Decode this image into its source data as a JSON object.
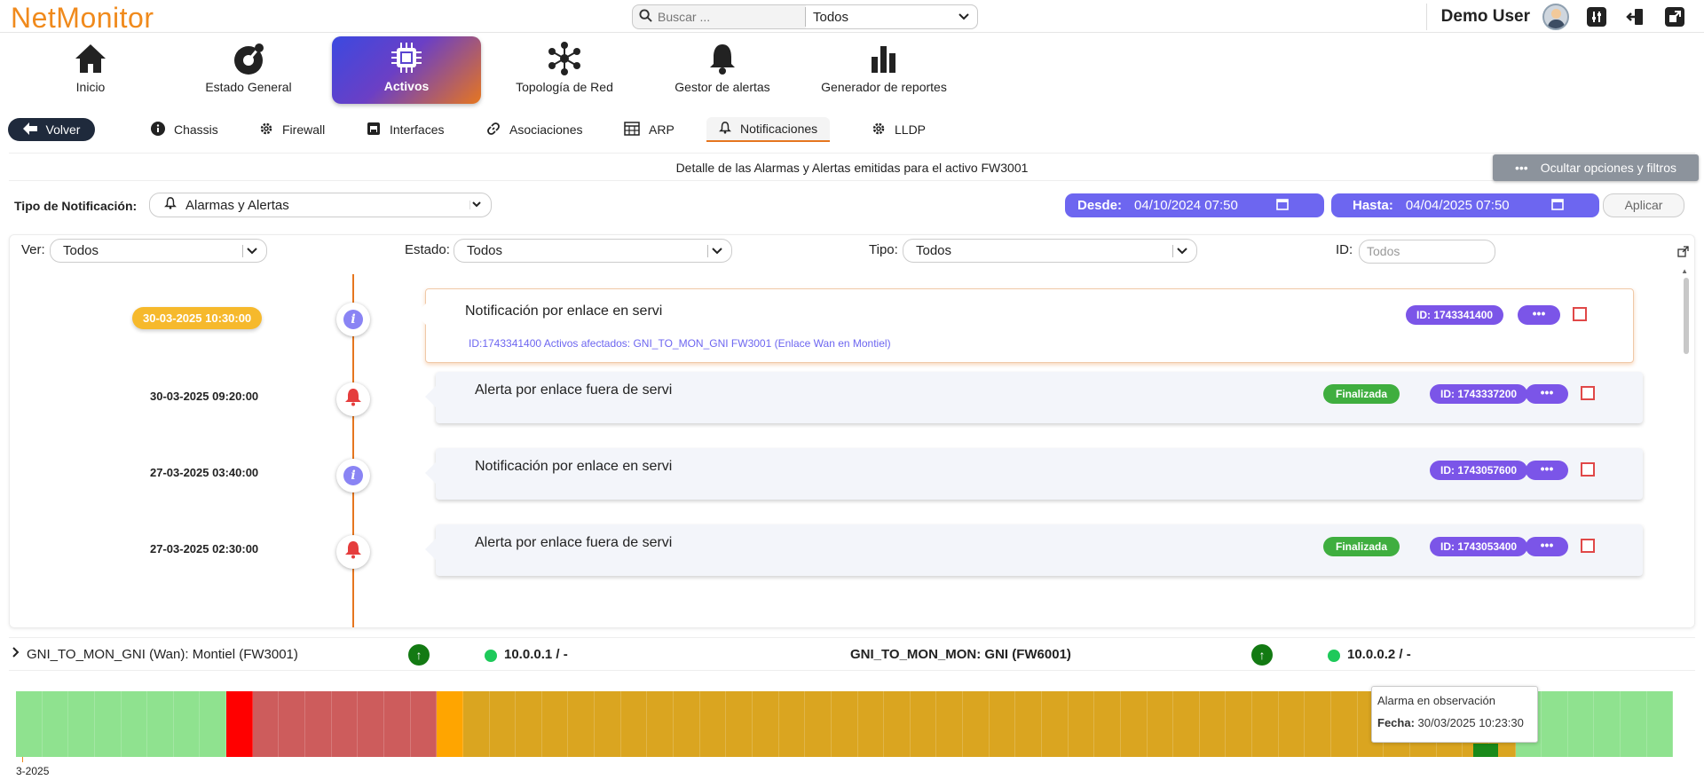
{
  "app": {
    "logo": "NetMonitor"
  },
  "search": {
    "placeholder": "Buscar ...",
    "scope": "Todos"
  },
  "user": {
    "name": "Demo User"
  },
  "nav": {
    "items": [
      {
        "label": "Inicio",
        "icon": "home-icon"
      },
      {
        "label": "Estado General",
        "icon": "gauge-icon"
      },
      {
        "label": "Activos",
        "icon": "chip-icon",
        "active": true
      },
      {
        "label": "Topología de Red",
        "icon": "network-icon"
      },
      {
        "label": "Gestor de alertas",
        "icon": "bell-icon"
      },
      {
        "label": "Generador de reportes",
        "icon": "bar-chart-icon"
      }
    ]
  },
  "subtabs": {
    "back": "Volver",
    "items": [
      {
        "label": "Chassis",
        "icon": "info-icon"
      },
      {
        "label": "Firewall",
        "icon": "gear-icon"
      },
      {
        "label": "Interfaces",
        "icon": "ethernet-icon"
      },
      {
        "label": "Asociaciones",
        "icon": "link-icon"
      },
      {
        "label": "ARP",
        "icon": "table-icon"
      },
      {
        "label": "Notificaciones",
        "icon": "bell-icon",
        "active": true
      },
      {
        "label": "LLDP",
        "icon": "gear-icon"
      }
    ]
  },
  "detail": {
    "title": "Detalle de las Alarmas y Alertas emitidas para el activo FW3001",
    "hide_button": "Ocultar opciones y filtros",
    "notif_type_label": "Tipo de Notificación:",
    "notif_type_value": "Alarmas y Alertas",
    "from_label": "Desde:",
    "from_value": "04/10/2024 07:50",
    "to_label": "Hasta:",
    "to_value": "04/04/2025 07:50",
    "apply": "Aplicar"
  },
  "filters": {
    "ver_label": "Ver:",
    "ver_value": "Todos",
    "estado_label": "Estado:",
    "estado_value": "Todos",
    "tipo_label": "Tipo:",
    "tipo_value": "Todos",
    "id_label": "ID:",
    "id_placeholder": "Todos"
  },
  "events": [
    {
      "date": "30-03-2025 10:30:00",
      "type": "info",
      "title": "Notificación por enlace en servi",
      "subtitle": "ID:1743341400 Activos afectados: GNI_TO_MON_GNI FW3001 (Enlace Wan en Montiel)",
      "id_badge": "ID: 1743341400",
      "status": "",
      "highlight": true
    },
    {
      "date": "30-03-2025 09:20:00",
      "type": "alert",
      "title": "Alerta por enlace fuera de servi",
      "subtitle": "",
      "id_badge": "ID: 1743337200",
      "status": "Finalizada",
      "highlight": false
    },
    {
      "date": "27-03-2025 03:40:00",
      "type": "info",
      "title": "Notificación por enlace en servi",
      "subtitle": "",
      "id_badge": "ID: 1743057600",
      "status": "",
      "highlight": false
    },
    {
      "date": "27-03-2025 02:30:00",
      "type": "alert",
      "title": "Alerta por enlace fuera de servi",
      "subtitle": "",
      "id_badge": "ID: 1743053400",
      "status": "Finalizada",
      "highlight": false
    }
  ],
  "dots_label": "•••",
  "link": {
    "left_name": "GNI_TO_MON_GNI (Wan): Montiel (FW3001)",
    "left_ip": "10.0.0.1 / -",
    "right_name": "GNI_TO_MON_MON: GNI (FW6001)",
    "right_ip": "10.0.0.2 / -",
    "up_symbol": "↑"
  },
  "status_bar": {
    "colors": {
      "ok": "#8fe28f",
      "down": "#ff0000",
      "down_dim": "#cd5c5c",
      "warn": "#ffa500",
      "observe": "#daa520"
    },
    "segments": [
      {
        "state": "ok",
        "units": 8
      },
      {
        "state": "down",
        "units": 1
      },
      {
        "state": "down_dim",
        "units": 7
      },
      {
        "state": "warn",
        "units": 1
      },
      {
        "state": "observe",
        "units": 40
      },
      {
        "state": "ok",
        "units": 6
      }
    ],
    "axis_label": "3-2025"
  },
  "tooltip": {
    "title": "Alarma en observación",
    "key": "Fecha:",
    "value": "30/03/2025 10:23:30"
  }
}
